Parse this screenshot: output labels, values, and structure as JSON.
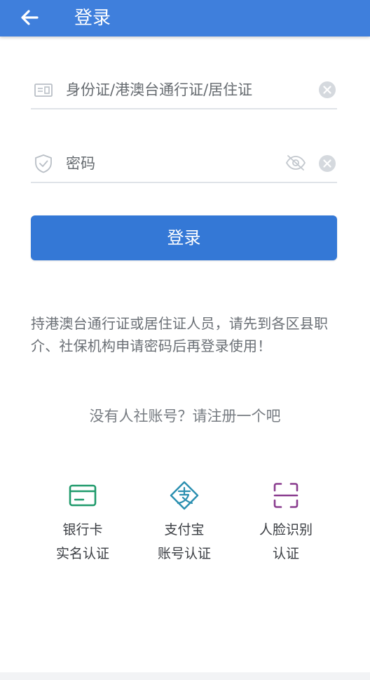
{
  "appbar": {
    "title": "登录",
    "back_icon": "arrow-left-icon",
    "background": "#3f7fdc"
  },
  "form": {
    "id_field": {
      "placeholder": "身份证/港澳台通行证/居住证",
      "value": "",
      "icon": "id-card-icon"
    },
    "password_field": {
      "placeholder": "密码",
      "value": "",
      "icon": "shield-check-icon",
      "visibility_icon": "eye-off-icon"
    },
    "clear_icon": "clear-circle-icon",
    "login_label": "登录",
    "login_color": "#3478d6"
  },
  "notice": "持港澳台通行证或居住证人员，请先到各区县职介、社保机构申请密码后再登录使用！",
  "register_text": "没有人社账号？请注册一个吧",
  "auth_options": [
    {
      "line1": "银行卡",
      "line2": "实名认证",
      "icon": "bank-card-icon",
      "color": "#1f9a6b"
    },
    {
      "line1": "支付宝",
      "line2": "账号认证",
      "icon": "alipay-icon",
      "color": "#2a8fb0"
    },
    {
      "line1": "人脸识别",
      "line2": "认证",
      "icon": "face-scan-icon",
      "color": "#8a3d8f"
    }
  ]
}
